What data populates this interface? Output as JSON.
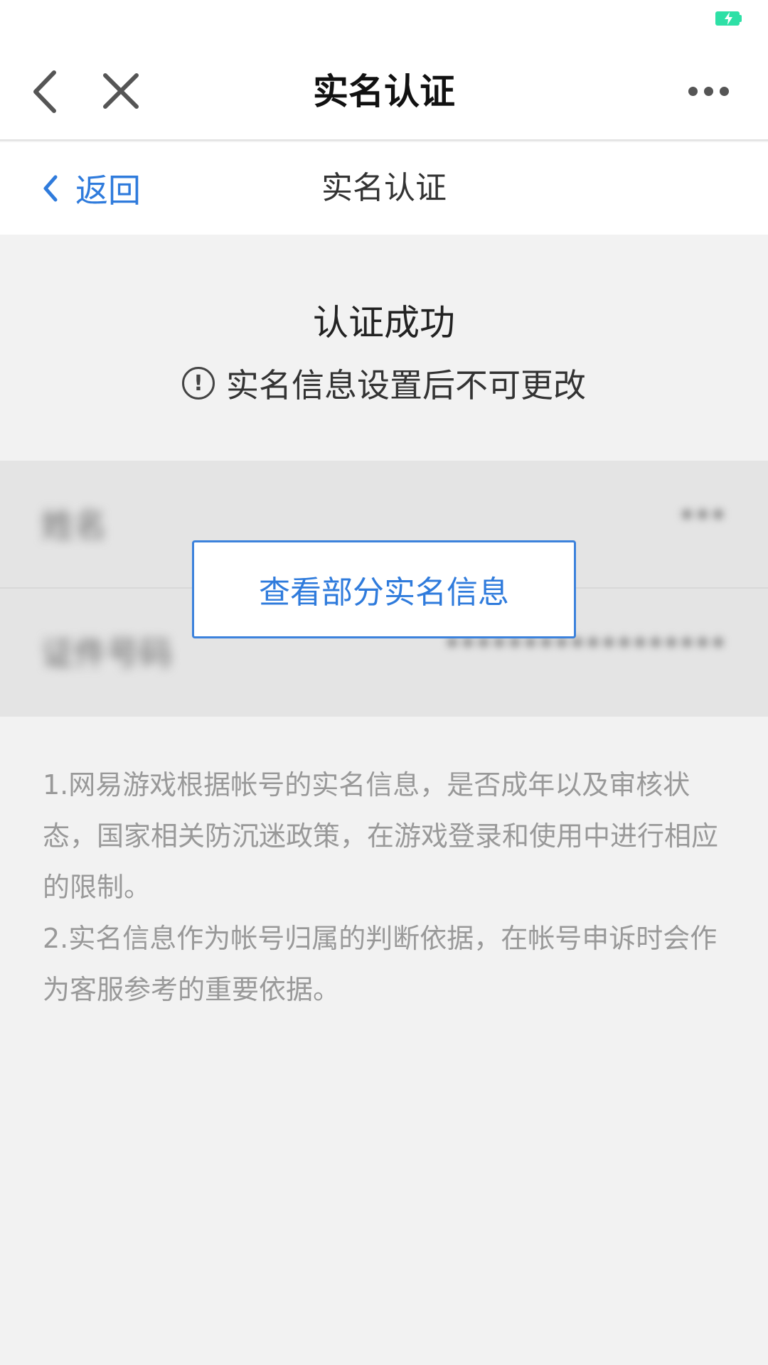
{
  "colors": {
    "accent": "#2f7bdc",
    "battery": "#2ee0a6",
    "page_bg": "#f2f2f2",
    "note_text": "#999999"
  },
  "appbar": {
    "title": "实名认证",
    "back_icon": "chevron-left-icon",
    "close_icon": "close-icon",
    "more_icon": "more-dots-icon"
  },
  "subnav": {
    "return_label": "返回",
    "title": "实名认证"
  },
  "status": {
    "success_title": "认证成功",
    "notice": "实名信息设置后不可更改",
    "notice_icon": "exclamation-circle-icon"
  },
  "info": {
    "rows": [
      {
        "label": "姓名",
        "value": "***"
      },
      {
        "label": "证件号码",
        "value": "******************"
      }
    ],
    "view_button": "查看部分实名信息"
  },
  "notes": [
    "1.网易游戏根据帐号的实名信息，是否成年以及审核状态，国家相关防沉迷政策，在游戏登录和使用中进行相应的限制。",
    "2.实名信息作为帐号归属的判断依据，在帐号申诉时会作为客服参考的重要依据。"
  ]
}
